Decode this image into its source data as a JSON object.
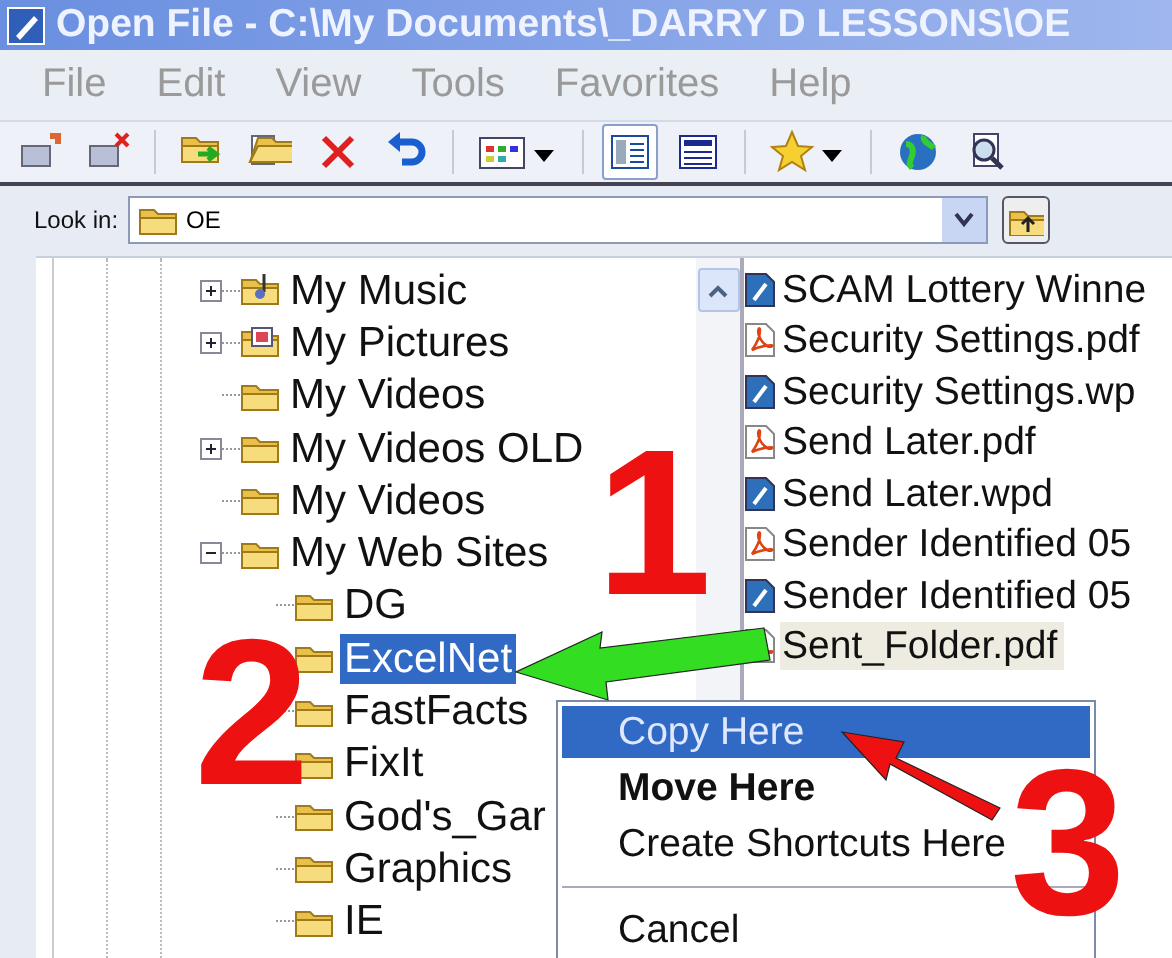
{
  "window": {
    "title": "Open File - C:\\My Documents\\_DARRY D LESSONS\\OE"
  },
  "menu_bar": [
    "File",
    "Edit",
    "View",
    "Tools",
    "Favorites",
    "Help"
  ],
  "toolbar": {
    "buttons": [
      {
        "kind": "connect",
        "pressed": false
      },
      {
        "kind": "disconnect",
        "pressed": false
      },
      {
        "kind": "separator"
      },
      {
        "kind": "move",
        "pressed": false
      },
      {
        "kind": "copy",
        "pressed": false
      },
      {
        "kind": "delete",
        "pressed": false
      },
      {
        "kind": "undo",
        "pressed": false
      },
      {
        "kind": "separator"
      },
      {
        "kind": "views",
        "pressed": false
      },
      {
        "kind": "separator"
      },
      {
        "kind": "details",
        "pressed": true
      },
      {
        "kind": "preview",
        "pressed": false
      },
      {
        "kind": "separator"
      },
      {
        "kind": "favorites",
        "pressed": false
      },
      {
        "kind": "separator"
      },
      {
        "kind": "web",
        "pressed": false
      },
      {
        "kind": "find",
        "pressed": false
      }
    ]
  },
  "look_in": {
    "label": "Look in:",
    "value": "OE"
  },
  "folder_tree": [
    {
      "label": "My Music",
      "kind": "music",
      "expanded": false,
      "selected": false
    },
    {
      "label": "My Pictures",
      "kind": "pictures",
      "expanded": false,
      "selected": false
    },
    {
      "label": "My Videos",
      "kind": "folder",
      "selected": false
    },
    {
      "label": "My Videos OLD",
      "kind": "folder",
      "expanded": false,
      "selected": false
    },
    {
      "label": "My Videos",
      "kind": "folder",
      "selected": false
    },
    {
      "label": "My Web Sites",
      "kind": "folder",
      "expanded": true,
      "selected": false,
      "children": [
        {
          "label": "DG",
          "kind": "folder",
          "selected": false
        },
        {
          "label": "ExcelNet",
          "kind": "folder",
          "selected": true
        },
        {
          "label": "FastFacts",
          "kind": "folder",
          "selected": false
        },
        {
          "label": "FixIt",
          "kind": "folder",
          "selected": false
        },
        {
          "label": "God's_Gar",
          "kind": "folder",
          "selected": false
        },
        {
          "label": "Graphics",
          "kind": "folder",
          "selected": false
        },
        {
          "label": "IE",
          "kind": "folder",
          "selected": false
        }
      ]
    }
  ],
  "file_list": [
    {
      "name": "SCAM Lottery Winne",
      "kind": "wpd",
      "selected": false
    },
    {
      "name": "Security Settings.pdf",
      "kind": "pdf",
      "selected": false
    },
    {
      "name": "Security Settings.wp",
      "kind": "wpd",
      "selected": false
    },
    {
      "name": "Send Later.pdf",
      "kind": "pdf",
      "selected": false
    },
    {
      "name": "Send Later.wpd",
      "kind": "wpd",
      "selected": false
    },
    {
      "name": "Sender Identified 05",
      "kind": "pdf",
      "selected": false
    },
    {
      "name": "Sender Identified 05",
      "kind": "wpd",
      "selected": false
    },
    {
      "name": "Sent_Folder.pdf",
      "kind": "pdf",
      "selected": true
    }
  ],
  "context_menu": [
    {
      "kind": "item",
      "label": "Copy Here",
      "selected": true,
      "default": false
    },
    {
      "kind": "item",
      "label": "Move Here",
      "selected": false,
      "default": true
    },
    {
      "kind": "item",
      "label": "Create Shortcuts Here",
      "selected": false,
      "default": false
    },
    {
      "kind": "separator"
    },
    {
      "kind": "item",
      "label": "Cancel",
      "selected": false,
      "default": false
    }
  ],
  "annotations": [
    {
      "kind": "number",
      "label": "1"
    },
    {
      "kind": "number",
      "label": "2"
    },
    {
      "kind": "number",
      "label": "3"
    },
    {
      "kind": "arrow",
      "color": "#33dd22"
    },
    {
      "kind": "arrow",
      "color": "#ee1111"
    }
  ]
}
